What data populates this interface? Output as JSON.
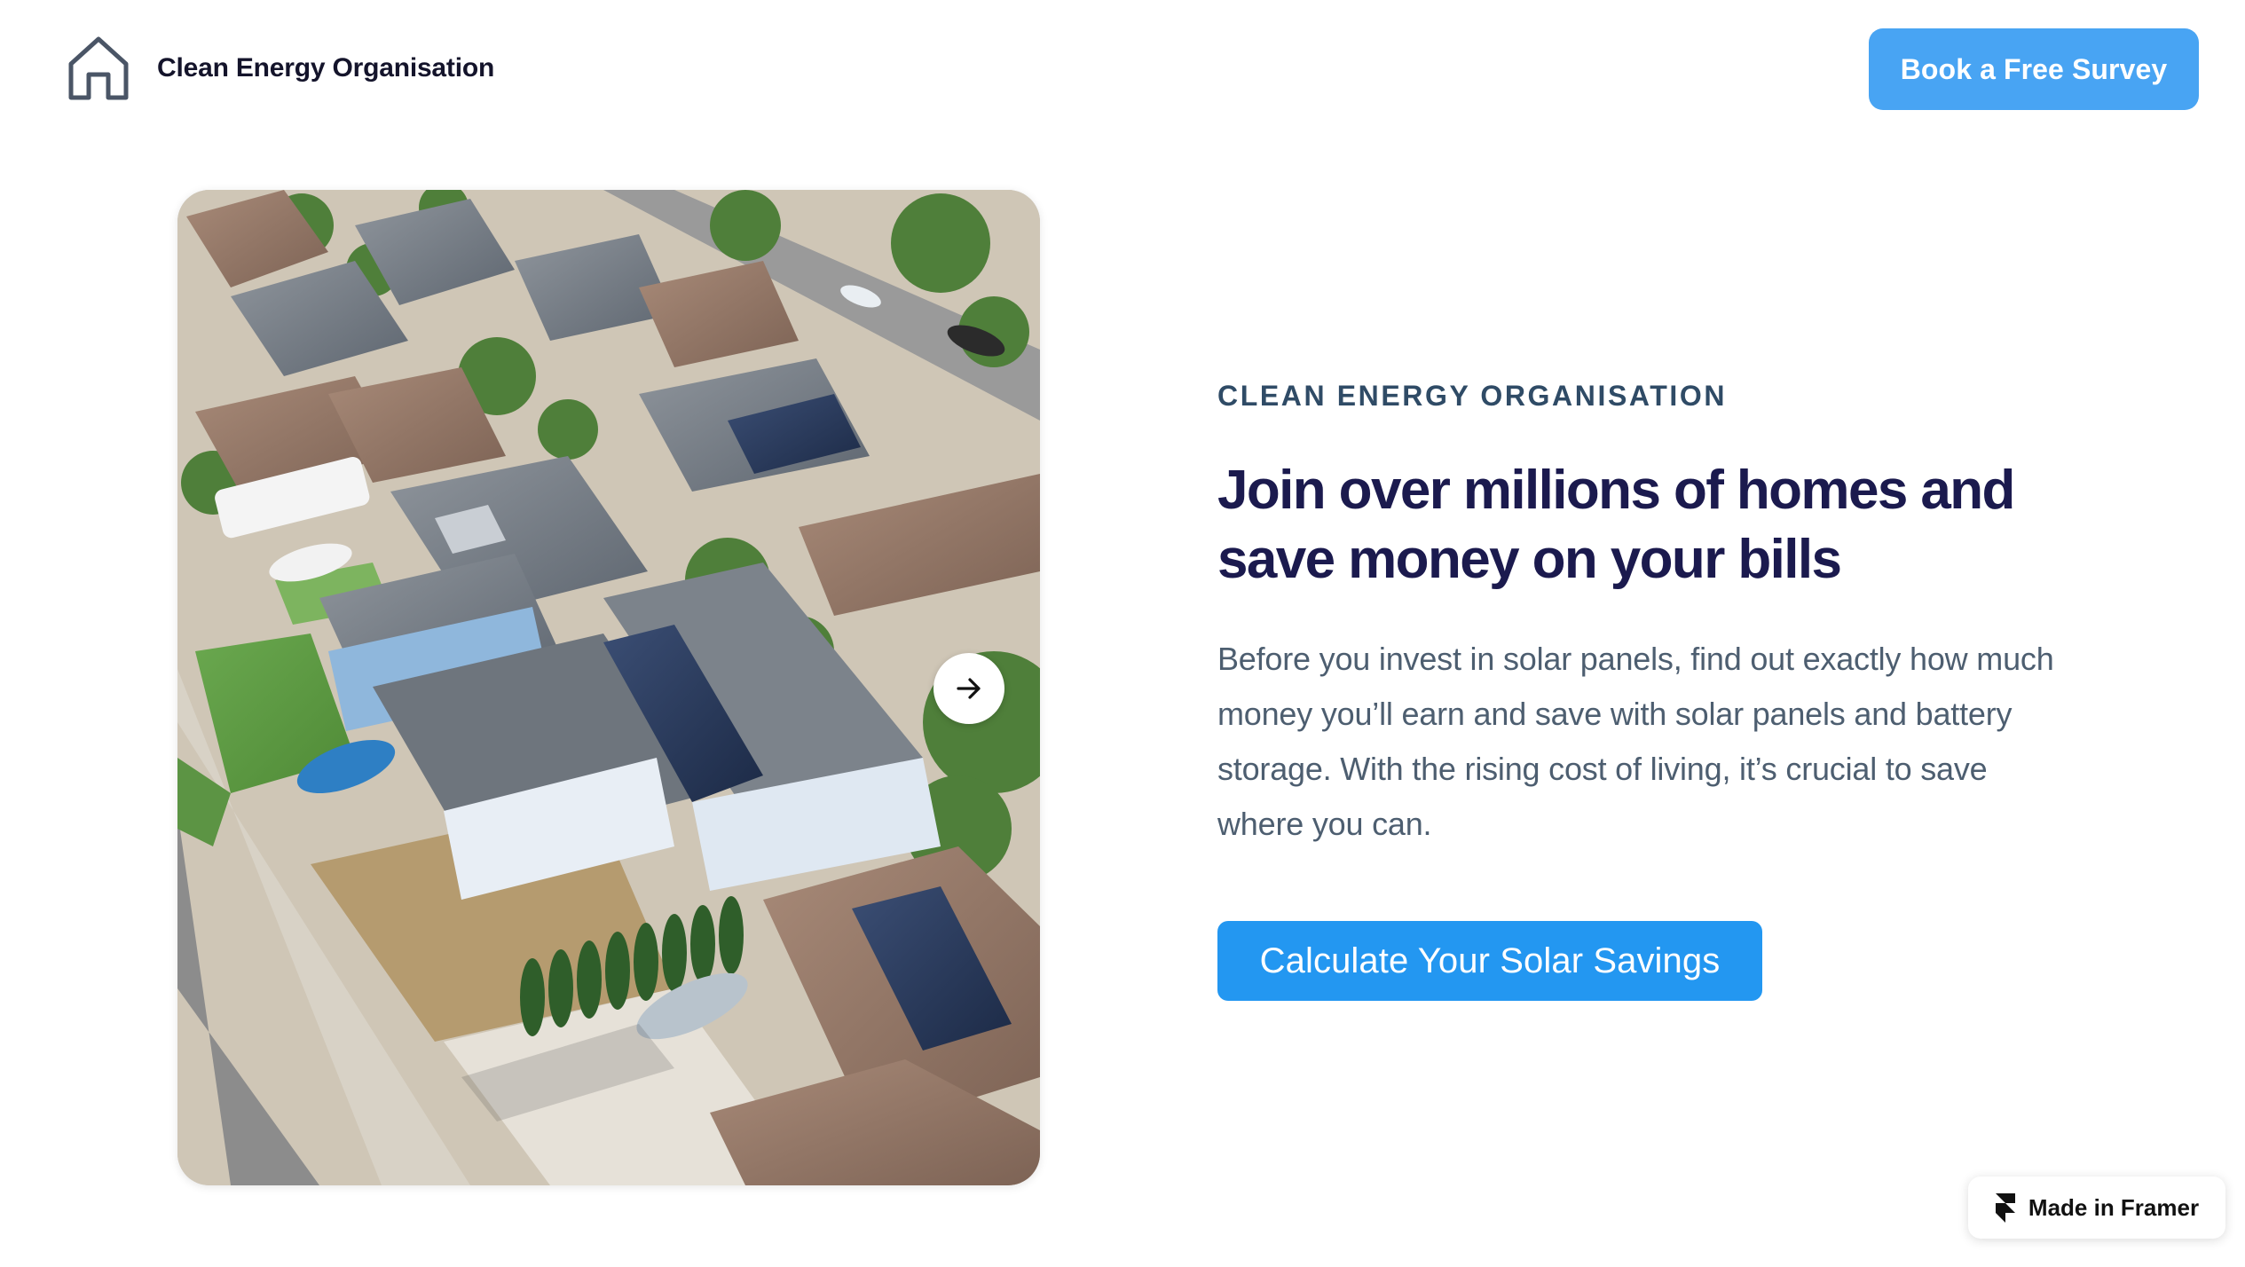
{
  "header": {
    "brand_name": "Clean Energy Organisation",
    "logo_icon": "house-outline-icon",
    "cta_label": "Book a Free Survey"
  },
  "hero": {
    "image_description": "aerial-photo-suburban-homes-with-solar-panels",
    "next_icon": "arrow-right-icon",
    "eyebrow": "CLEAN ENERGY ORGANISATION",
    "headline": "Join over millions of homes and save money on your bills",
    "body": "Before you invest in solar panels, find out exactly how much money you’ll earn and save with solar panels and battery storage. With the rising cost of living, it’s crucial to save where you can.",
    "cta_label": "Calculate Your Solar Savings"
  },
  "badge": {
    "icon": "framer-logo-icon",
    "label": "Made in Framer"
  },
  "colors": {
    "header_cta": "#48a4f3",
    "primary_cta": "#2397f1",
    "headline": "#1b1a4e",
    "eyebrow": "#2f4b66",
    "body": "#4d5e70"
  }
}
